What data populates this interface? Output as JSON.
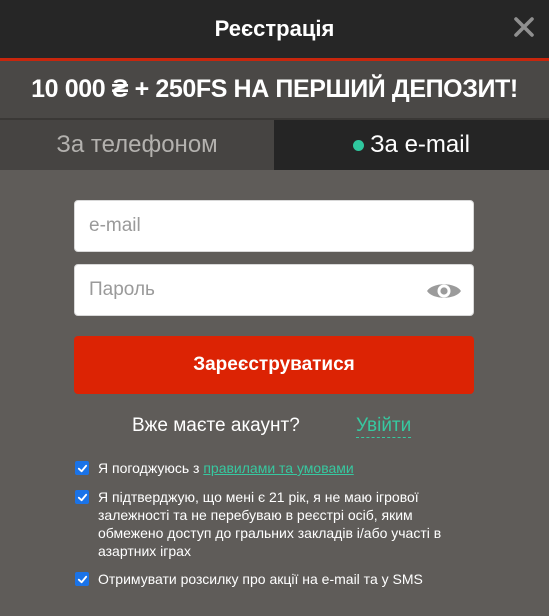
{
  "header": {
    "title": "Реєстрація",
    "close_icon": "close-icon"
  },
  "promo": {
    "text": "10 000 ₴ + 250FS НА ПЕРШИЙ ДЕПОЗИТ!"
  },
  "tabs": [
    {
      "label": "За телефоном",
      "active": false
    },
    {
      "label": "За e-mail",
      "active": true
    }
  ],
  "form": {
    "email_placeholder": "e-mail",
    "password_placeholder": "Пароль",
    "show_password_icon": "eye-icon",
    "register_label": "Зареєструватися"
  },
  "login": {
    "prompt": "Вже маєте акаунт?",
    "link": "Увійти"
  },
  "checkboxes": {
    "terms_prefix": "Я погоджуюсь з ",
    "terms_link": "правилами та умовами",
    "age_text": "Я підтверджую, що мені є 21 рік, я не маю ігрової залежності та не перебуваю в реєстрі осіб, яким обмежено доступ до гральних закладів і/або участі в азартних іграх",
    "newsletter_text": "Отримувати розсилку про акції на e-mail та у SMS",
    "terms_checked": true,
    "age_checked": true,
    "newsletter_checked": true
  },
  "colors": {
    "accent_red": "#dc2304",
    "accent_teal": "#37c8a0",
    "checkbox_blue": "#1a73e8",
    "background": "#5f5c59",
    "header_bg": "#262626"
  }
}
